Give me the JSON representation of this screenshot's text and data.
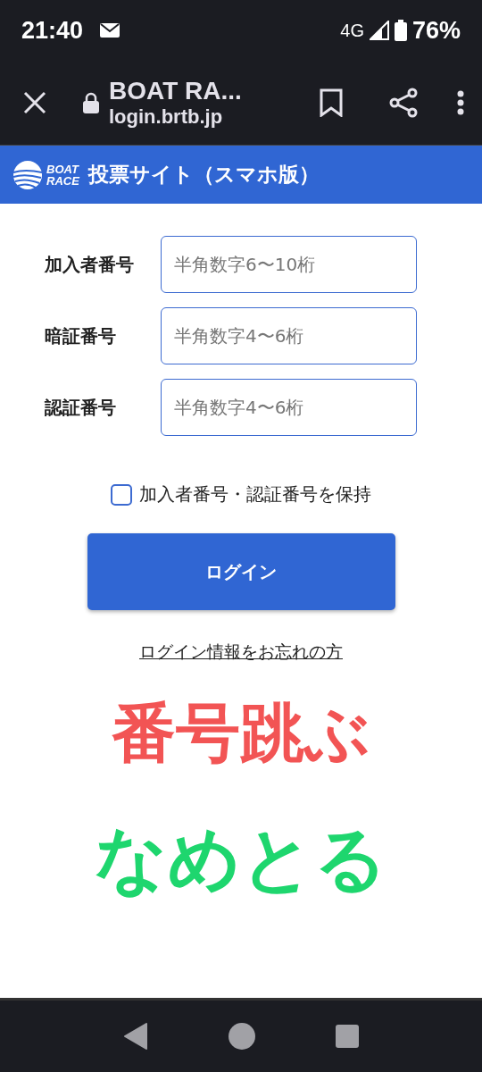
{
  "status_bar": {
    "time": "21:40",
    "network": "4G",
    "battery": "76%"
  },
  "browser": {
    "title": "BOAT RA...",
    "url": "login.brtb.jp"
  },
  "site_header": {
    "logo_top": "BOAT",
    "logo_bottom": "RACE",
    "title": "投票サイト（スマホ版）"
  },
  "form": {
    "fields": [
      {
        "label": "加入者番号",
        "placeholder": "半角数字6〜10桁"
      },
      {
        "label": "暗証番号",
        "placeholder": "半角数字4〜6桁"
      },
      {
        "label": "認証番号",
        "placeholder": "半角数字4〜6桁"
      }
    ],
    "remember": {
      "label": "加入者番号・認証番号を保持",
      "checked": false
    },
    "login_button": "ログイン",
    "forgot_link": "ログイン情報をお忘れの方"
  },
  "overlay_texts": [
    {
      "text": "番号跳ぶ",
      "color": "#f25454"
    },
    {
      "text": "なめとる",
      "color": "#1ed66e"
    }
  ]
}
